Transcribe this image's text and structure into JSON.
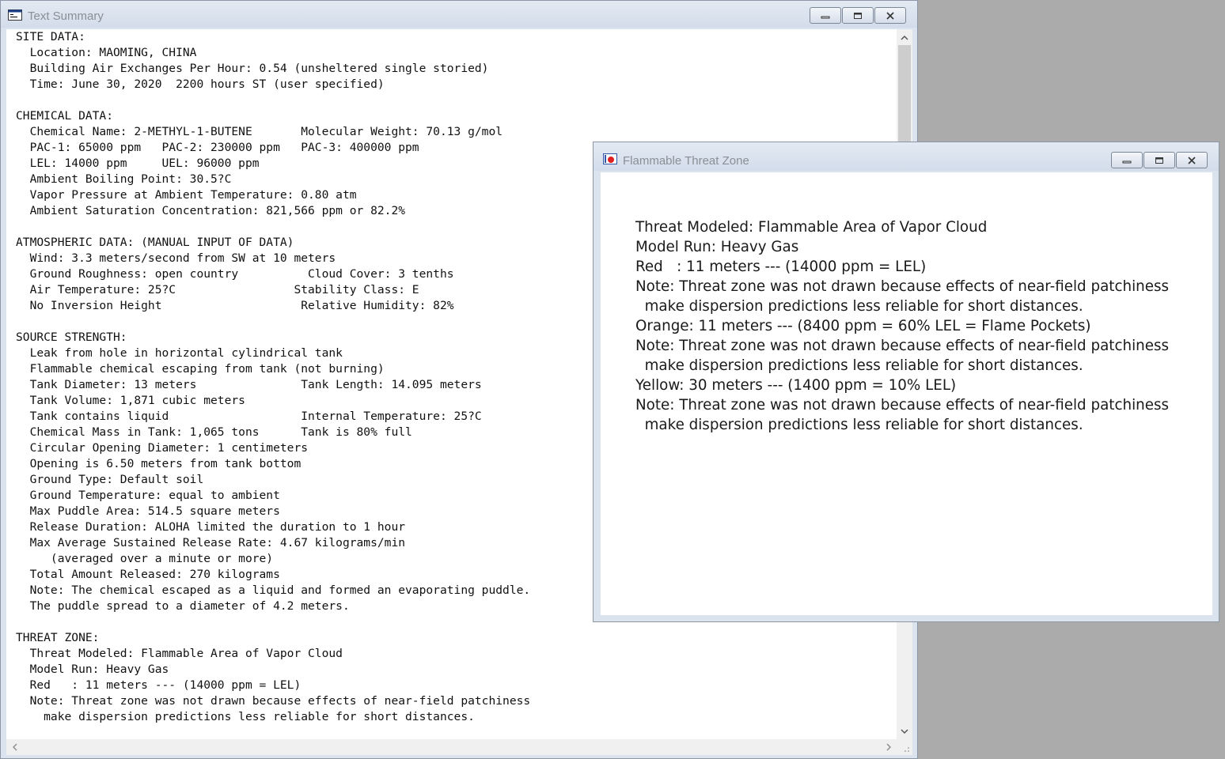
{
  "summary_window": {
    "title": "Text Summary",
    "lines": [
      "SITE DATA:",
      "  Location: MAOMING, CHINA",
      "  Building Air Exchanges Per Hour: 0.54 (unsheltered single storied)",
      "  Time: June 30, 2020  2200 hours ST (user specified)",
      "",
      "CHEMICAL DATA:",
      "  Chemical Name: 2-METHYL-1-BUTENE       Molecular Weight: 70.13 g/mol",
      "  PAC-1: 65000 ppm   PAC-2: 230000 ppm   PAC-3: 400000 ppm",
      "  LEL: 14000 ppm     UEL: 96000 ppm",
      "  Ambient Boiling Point: 30.5?C",
      "  Vapor Pressure at Ambient Temperature: 0.80 atm",
      "  Ambient Saturation Concentration: 821,566 ppm or 82.2%",
      "",
      "ATMOSPHERIC DATA: (MANUAL INPUT OF DATA)",
      "  Wind: 3.3 meters/second from SW at 10 meters",
      "  Ground Roughness: open country          Cloud Cover: 3 tenths",
      "  Air Temperature: 25?C                 Stability Class: E",
      "  No Inversion Height                    Relative Humidity: 82%",
      "",
      "SOURCE STRENGTH:",
      "  Leak from hole in horizontal cylindrical tank",
      "  Flammable chemical escaping from tank (not burning)",
      "  Tank Diameter: 13 meters               Tank Length: 14.095 meters",
      "  Tank Volume: 1,871 cubic meters",
      "  Tank contains liquid                   Internal Temperature: 25?C",
      "  Chemical Mass in Tank: 1,065 tons      Tank is 80% full",
      "  Circular Opening Diameter: 1 centimeters",
      "  Opening is 6.50 meters from tank bottom",
      "  Ground Type: Default soil",
      "  Ground Temperature: equal to ambient",
      "  Max Puddle Area: 514.5 square meters",
      "  Release Duration: ALOHA limited the duration to 1 hour",
      "  Max Average Sustained Release Rate: 4.67 kilograms/min",
      "     (averaged over a minute or more)",
      "  Total Amount Released: 270 kilograms",
      "  Note: The chemical escaped as a liquid and formed an evaporating puddle.",
      "  The puddle spread to a diameter of 4.2 meters.",
      "",
      "THREAT ZONE:",
      "  Threat Modeled: Flammable Area of Vapor Cloud",
      "  Model Run: Heavy Gas",
      "  Red   : 11 meters --- (14000 ppm = LEL)",
      "  Note: Threat zone was not drawn because effects of near-field patchiness",
      "    make dispersion predictions less reliable for short distances."
    ]
  },
  "flame_window": {
    "title": "Flammable Threat Zone",
    "lines": [
      "Threat Modeled: Flammable Area of Vapor Cloud",
      "Model Run: Heavy Gas",
      "Red   : 11 meters --- (14000 ppm = LEL)",
      "Note: Threat zone was not drawn because effects of near-field patchiness",
      "  make dispersion predictions less reliable for short distances.",
      "Orange: 11 meters --- (8400 ppm = 60% LEL = Flame Pockets)",
      "Note: Threat zone was not drawn because effects of near-field patchiness",
      "  make dispersion predictions less reliable for short distances.",
      "Yellow: 30 meters --- (1400 ppm = 10% LEL)",
      "Note: Threat zone was not drawn because effects of near-field patchiness",
      "  make dispersion predictions less reliable for short distances."
    ]
  },
  "icons": {
    "summary_window": "text-document-icon",
    "flame_window": "threat-zone-icon",
    "controls": [
      "minimize-icon",
      "restore-icon",
      "close-icon"
    ],
    "scroll": [
      "scroll-up-icon",
      "scroll-down-icon",
      "scroll-left-icon",
      "scroll-right-icon"
    ]
  }
}
